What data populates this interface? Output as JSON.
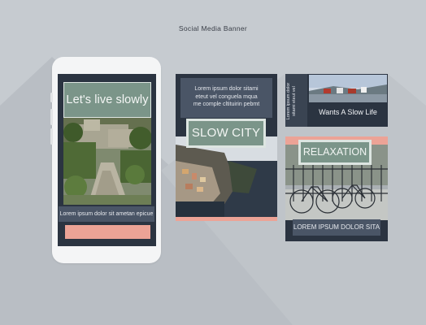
{
  "header": {
    "title": "Social Media Banner"
  },
  "phone_post": {
    "headline": "Let's live slowly",
    "caption": "Lorem ipsum dolor sit ametan epicue"
  },
  "story_card": {
    "paragraph_lines": [
      "Lorem ipsum dolor sitami",
      "eteut vel conguela mqua",
      "me comple cltituirin pebmt"
    ],
    "headline": "SLOW CITY"
  },
  "landscape_card": {
    "vertical_lines": [
      "Lorem ipsum dolor",
      "sitami eteut vel"
    ],
    "headline": "Wants A Slow Life"
  },
  "square_card": {
    "headline": "RELAXATION",
    "caption": "LOREM IPSUM DOLOR SITA"
  },
  "colors": {
    "background": "#c6cbd0",
    "navy": "#2b3441",
    "slate": "#4a5566",
    "sage": "#7b9589",
    "coral": "#eca396"
  }
}
